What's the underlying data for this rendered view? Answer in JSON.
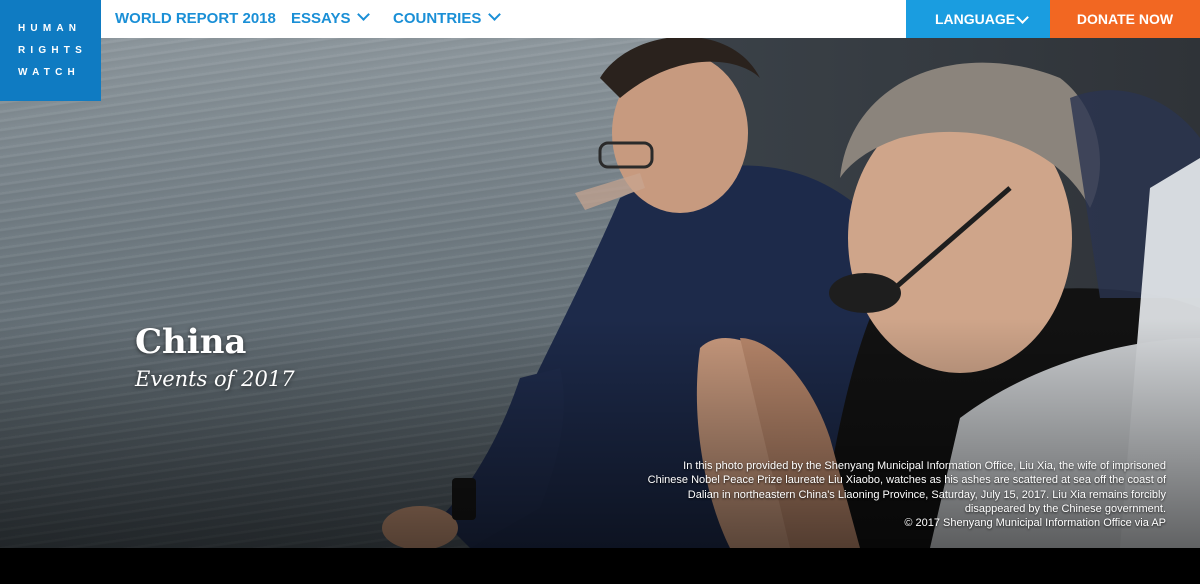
{
  "logo": {
    "lines": [
      "HUMAN",
      "RIGHTS",
      "WATCH"
    ]
  },
  "nav": {
    "world_report": "WORLD REPORT 2018",
    "essays": "ESSAYS",
    "countries": "COUNTRIES",
    "language": "LANGUAGE",
    "donate": "DONATE NOW"
  },
  "hero": {
    "title": "China",
    "subtitle": "Events of 2017",
    "caption": "In this photo provided by the Shenyang Municipal Information Office, Liu Xia, the wife of imprisoned Chinese Nobel Peace Prize laureate Liu Xiaobo, watches as his ashes are scattered at sea off the coast of Dalian in northeastern China's Liaoning Province, Saturday, July 15, 2017. Liu Xia remains forcibly disappeared by the Chinese government.",
    "credit": "© 2017 Shenyang Municipal Information Office via AP"
  },
  "colors": {
    "logo_bg": "#0f7bc2",
    "nav_text": "#1a8fd6",
    "language_bg": "#1a9de0",
    "donate_bg": "#f26722"
  }
}
